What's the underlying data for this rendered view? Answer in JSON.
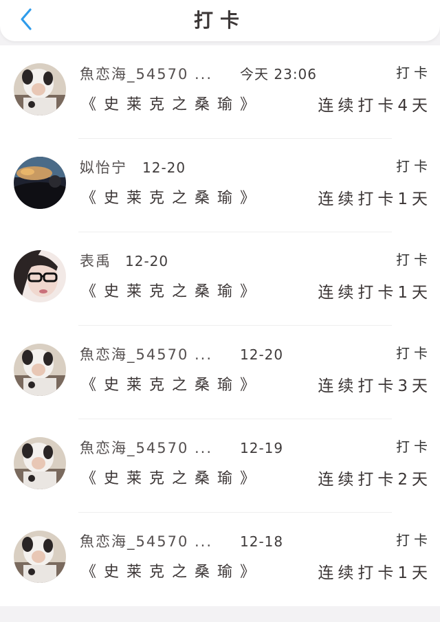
{
  "header": {
    "title": "打卡",
    "back_icon": "chevron-left-icon",
    "accent": "#2f9ceb"
  },
  "records": [
    {
      "user": "魚恋海_54570 ...",
      "time": "今天 23:06",
      "tag": "打卡",
      "book": "《史莱克之桑瑜》",
      "streak": "连续打卡4天",
      "avatar": "panda-hood-avatar"
    },
    {
      "user": "姒怡宁",
      "time": "12-20",
      "tag": "打卡",
      "book": "《史莱克之桑瑜》",
      "streak": "连续打卡1天",
      "avatar": "sunset-avatar"
    },
    {
      "user": "表禹",
      "time": "12-20",
      "tag": "打卡",
      "book": "《史莱克之桑瑜》",
      "streak": "连续打卡1天",
      "avatar": "glasses-girl-avatar"
    },
    {
      "user": "魚恋海_54570 ...",
      "time": "12-20",
      "tag": "打卡",
      "book": "《史莱克之桑瑜》",
      "streak": "连续打卡3天",
      "avatar": "panda-hood-avatar"
    },
    {
      "user": "魚恋海_54570 ...",
      "time": "12-19",
      "tag": "打卡",
      "book": "《史莱克之桑瑜》",
      "streak": "连续打卡2天",
      "avatar": "panda-hood-avatar"
    },
    {
      "user": "魚恋海_54570 ...",
      "time": "12-18",
      "tag": "打卡",
      "book": "《史莱克之桑瑜》",
      "streak": "连续打卡1天",
      "avatar": "panda-hood-avatar"
    }
  ]
}
